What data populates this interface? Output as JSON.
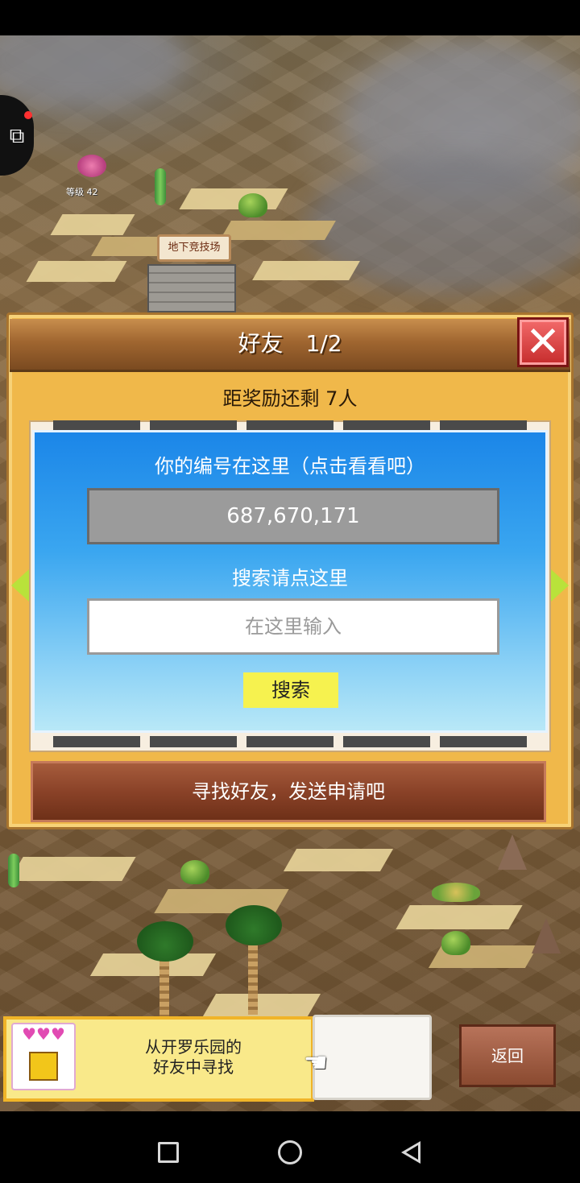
{
  "map": {
    "arena_label": "地下竞技场",
    "player_level_label": "等级 42"
  },
  "dialog": {
    "title": "好友　1/2",
    "reward_text": "距奖励还剩 7人",
    "id_caption": "你的编号在这里（点击看看吧）",
    "player_id": "687,670,171",
    "search_caption": "搜索请点这里",
    "search_placeholder": "在这里输入",
    "search_button": "搜索",
    "find_friends_button": "寻找好友，发送申请吧"
  },
  "bottom_bar": {
    "kairo_text_line1": "从开罗乐园的",
    "kairo_text_line2": "好友中寻找",
    "back_button": "返回"
  },
  "icons": {
    "close": "close-icon",
    "side": "puzzle-icon",
    "arrow_left": "arrow-left-icon",
    "arrow_right": "arrow-right-icon",
    "hand": "pointing-hand-icon"
  },
  "colors": {
    "dialog_bg": "#f0b84a",
    "panel_blue": "#1b86e8",
    "search_button": "#f6f24f",
    "close_red": "#c52b2b"
  }
}
